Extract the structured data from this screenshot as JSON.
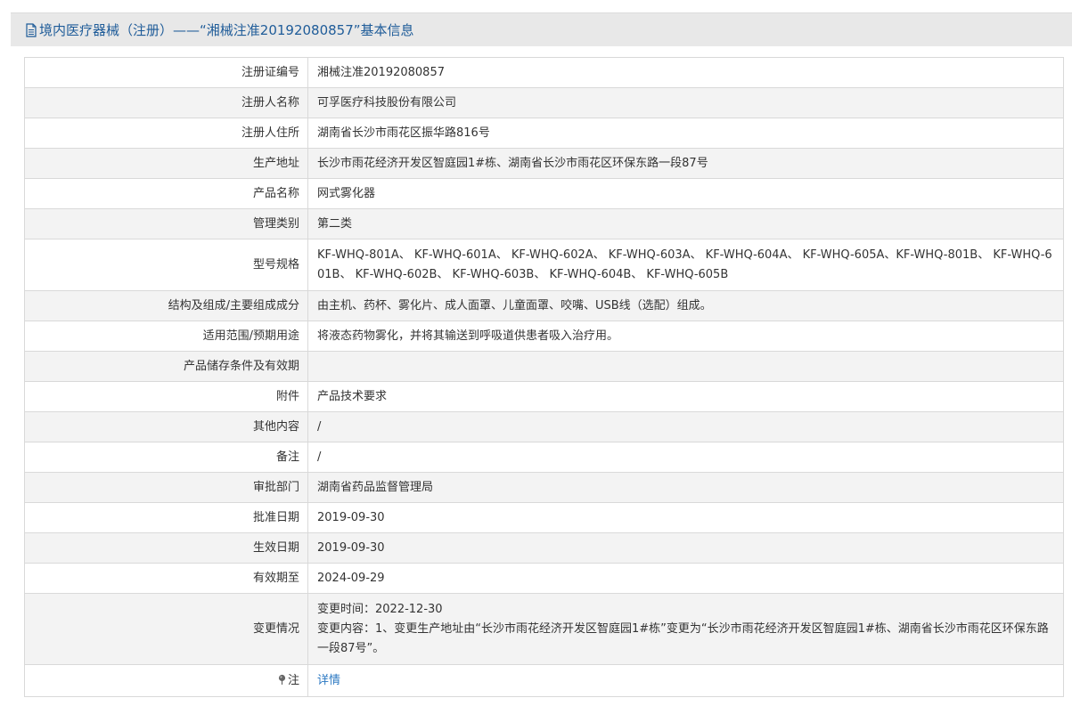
{
  "header": {
    "title": "境内医疗器械（注册）——“湘械注准20192080857”基本信息",
    "icon": "document-icon"
  },
  "rows": [
    {
      "label": "注册证编号",
      "value": "湘械注准20192080857"
    },
    {
      "label": "注册人名称",
      "value": "可孚医疗科技股份有限公司"
    },
    {
      "label": "注册人住所",
      "value": "湖南省长沙市雨花区振华路816号"
    },
    {
      "label": "生产地址",
      "value": "长沙市雨花经济开发区智庭园1#栋、湖南省长沙市雨花区环保东路一段87号"
    },
    {
      "label": "产品名称",
      "value": "网式雾化器"
    },
    {
      "label": "管理类别",
      "value": "第二类"
    },
    {
      "label": "型号规格",
      "value": "KF-WHQ-801A、 KF-WHQ-601A、 KF-WHQ-602A、 KF-WHQ-603A、 KF-WHQ-604A、 KF-WHQ-605A、KF-WHQ-801B、 KF-WHQ-601B、 KF-WHQ-602B、 KF-WHQ-603B、 KF-WHQ-604B、 KF-WHQ-605B"
    },
    {
      "label": "结构及组成/主要组成成分",
      "value": "由主机、药杯、雾化片、成人面罩、儿童面罩、咬嘴、USB线（选配）组成。"
    },
    {
      "label": "适用范围/预期用途",
      "value": "将液态药物雾化，并将其输送到呼吸道供患者吸入治疗用。"
    },
    {
      "label": "产品储存条件及有效期",
      "value": ""
    },
    {
      "label": "附件",
      "value": "产品技术要求"
    },
    {
      "label": "其他内容",
      "value": "/"
    },
    {
      "label": "备注",
      "value": "/"
    },
    {
      "label": "审批部门",
      "value": "湖南省药品监督管理局"
    },
    {
      "label": "批准日期",
      "value": "2019-09-30"
    },
    {
      "label": "生效日期",
      "value": "2019-09-30"
    },
    {
      "label": "有效期至",
      "value": "2024-09-29"
    }
  ],
  "change": {
    "label": "变更情况",
    "time": "变更时间：2022-12-30",
    "content": "变更内容：1、变更生产地址由“长沙市雨花经济开发区智庭园1#栋”变更为“长沙市雨花经济开发区智庭园1#栋、湖南省长沙市雨花区环保东路一段87号”。"
  },
  "note": {
    "label": "注",
    "icon": "pin-icon",
    "link": "详情"
  },
  "colors": {
    "title_text": "#1f5c99",
    "title_bg": "#e8e8e8",
    "row_alt": "#f3f3f3",
    "border": "#d9d9d9",
    "link": "#2b78c2"
  }
}
